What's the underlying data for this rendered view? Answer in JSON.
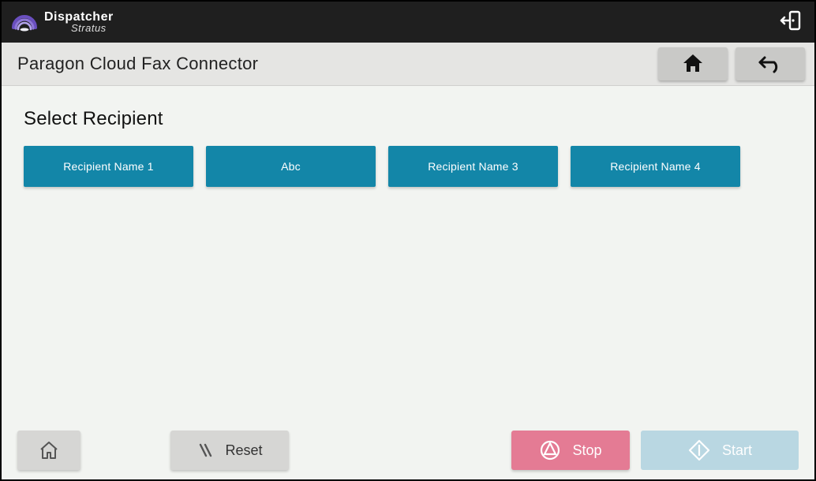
{
  "brand": {
    "name": "Dispatcher",
    "sub": "Stratus"
  },
  "header": {
    "title": "Paragon Cloud Fax Connector"
  },
  "section": {
    "title": "Select Recipient",
    "recipients": [
      "Recipient Name 1",
      "Abc",
      "Recipient Name 3",
      "Recipient Name 4"
    ]
  },
  "footer": {
    "reset": "Reset",
    "stop": "Stop",
    "start": "Start"
  }
}
